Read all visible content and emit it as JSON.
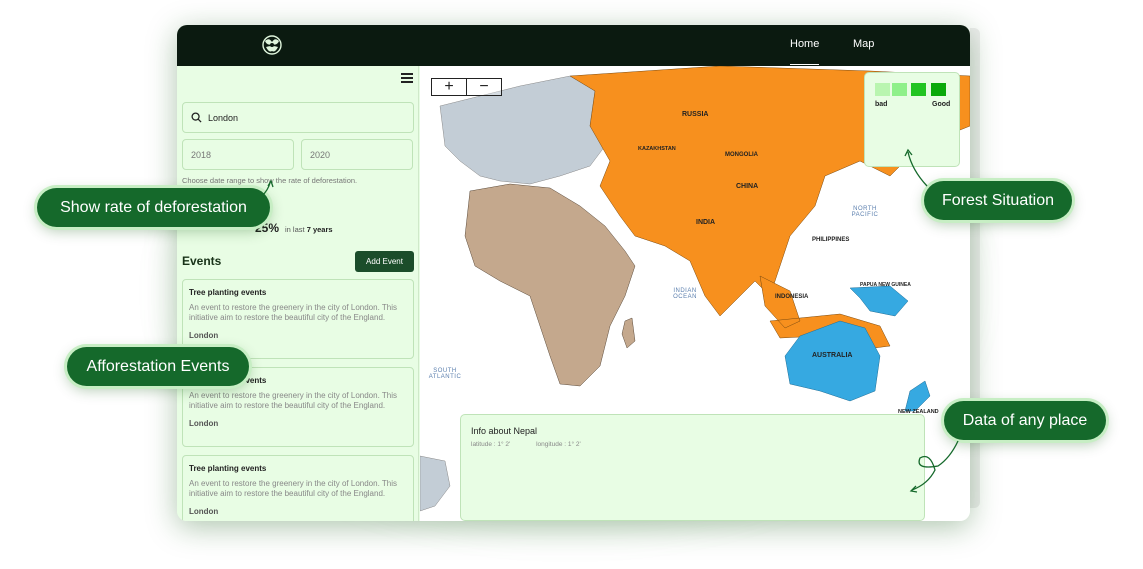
{
  "nav": {
    "home": "Home",
    "map": "Map"
  },
  "sidebar": {
    "search_value": "London",
    "date_from": "2018",
    "date_to": "2020",
    "hint": "Choose date range to show the rate of deforestation.",
    "rate_value": "25%",
    "rate_prefix": "in last",
    "rate_period": "7 years",
    "events_heading": "Events",
    "add_event_label": "Add Event",
    "events": [
      {
        "title": "Tree planting events",
        "description": "An event to restore the greenery in the city of London. This initiative aim to restore the beautiful city of the England.",
        "location": "London"
      },
      {
        "title": "Tree planting events",
        "description": "An event to restore the greenery in the city of London. This initiative aim to restore the beautiful city of the England.",
        "location": "London"
      },
      {
        "title": "Tree planting events",
        "description": "An event to restore the greenery in the city of London. This initiative aim to restore the beautiful city of the England.",
        "location": "London"
      }
    ]
  },
  "map": {
    "zoom_in": "+",
    "zoom_out": "−",
    "legend": {
      "bad": "bad",
      "good": "Good",
      "colors": [
        "#b9f5b0",
        "#8ff08a",
        "#22c422",
        "#0aa90a"
      ]
    },
    "labels": {
      "russia": "RUSSIA",
      "kazakhstan": "KAZAKHSTAN",
      "mongolia": "MONGOLIA",
      "china": "CHINA",
      "india": "INDIA",
      "philippines": "PHILIPPINES",
      "indonesia": "INDONESIA",
      "papua": "PAPUA NEW GUINEA",
      "australia": "AUSTRALIA",
      "new_zealand": "NEW ZEALAND"
    },
    "oceans": {
      "indian": "INDIAN OCEAN",
      "north_pacific": "NORTH PACIFIC",
      "south_atlantic": "SOUTH ATLANTIC"
    },
    "info": {
      "title": "Info about Nepal",
      "latitude": "latitude : 1° 2'",
      "longitude": "longitude : 1° 2'"
    },
    "colors": {
      "forest_orange": "#f7901e",
      "africa": "#c4a88d",
      "europe": "#c3cdd6",
      "australia": "#36a9e1"
    }
  },
  "callouts": {
    "deforestation": "Show rate of deforestation",
    "forest": "Forest Situation",
    "events": "Afforestation Events",
    "place": "Data of any place"
  }
}
